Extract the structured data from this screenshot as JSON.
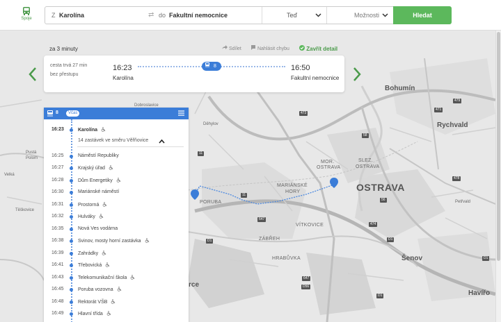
{
  "header": {
    "logo_caption": "Spoje",
    "from_prefix": "Z",
    "from_value": "Karolína",
    "to_prefix": "do",
    "to_value": "Fakultní nemocnice",
    "time_value": "Teď",
    "options_label": "Možnosti",
    "search_button": "Hledat"
  },
  "result": {
    "departs_in": "za 3 minuty",
    "share_label": "Sdílet",
    "report_label": "Nahlásit chybu",
    "close_label": "Zavřít detail",
    "duration": "cesta trvá 27 min",
    "transfers": "bez přestupu",
    "depart_time": "16:23",
    "depart_stop": "Karolína",
    "arrive_time": "16:50",
    "arrive_stop": "Fakultní nemocnice",
    "line_number": "8"
  },
  "detail": {
    "line_number": "8",
    "badge": "Včas",
    "first_stop": {
      "time": "16:23",
      "name": "Karolína"
    },
    "direction_text": "14 zastávek ve směru Věřňovice",
    "stops": [
      {
        "time": "16:25",
        "name": "Náměstí Republiky"
      },
      {
        "time": "16:27",
        "name": "Krajský úřad"
      },
      {
        "time": "16:28",
        "name": "Dům Energetiky"
      },
      {
        "time": "16:30",
        "name": "Mariánské náměstí"
      },
      {
        "time": "16:31",
        "name": "Prostorná"
      },
      {
        "time": "16:32",
        "name": "Hulváky"
      },
      {
        "time": "16:35",
        "name": "Nová Ves vodárna"
      },
      {
        "time": "16:38",
        "name": "Svinov, mosty horní zastávka"
      },
      {
        "time": "16:39",
        "name": "Zahrádky"
      },
      {
        "time": "16:41",
        "name": "Třebovická"
      },
      {
        "time": "16:43",
        "name": "Telekomunikační škola"
      },
      {
        "time": "16:45",
        "name": "Poruba vozovna"
      },
      {
        "time": "16:48",
        "name": "Rektorát VŠB"
      },
      {
        "time": "16:49",
        "name": "Hlavní třída"
      }
    ]
  },
  "map": {
    "labels": {
      "bohumin": "Bohumín",
      "rychvald": "Rychvald",
      "ostrava": "OSTRAVA",
      "senov": "Šenov",
      "havirov": "Havířo",
      "petrvald": "Petřvald",
      "dehylov": "Děhylov",
      "poruba": "PORUBA",
      "zabreh": "ZÁBŘEH",
      "vitkovice": "VÍTKOVICE",
      "hrabuvka": "HRABŮVKA",
      "marianske_hory_1": "MARIÁNSKÉ",
      "marianske_hory_2": "HORY",
      "slez_1": "SLEZ.",
      "slez_2": "OSTRAVA",
      "mor_1": "MOR.",
      "mor_2": "OSTRAVA",
      "pusta_1": "Pustá",
      "pusta_2": "Polom",
      "teskovice": "Těškovice",
      "dobroslavice": "Dobroslavice",
      "velka": "Velká",
      "rce": "rce"
    },
    "shields": [
      "D1",
      "D1",
      "D1",
      "58",
      "56",
      "11",
      "471",
      "473",
      "647",
      "647",
      "11",
      "D56",
      "D1",
      "478",
      "479",
      "474",
      "59"
    ]
  },
  "colors": {
    "brand_green": "#5cb85c",
    "route_blue": "#3b7dd8"
  }
}
